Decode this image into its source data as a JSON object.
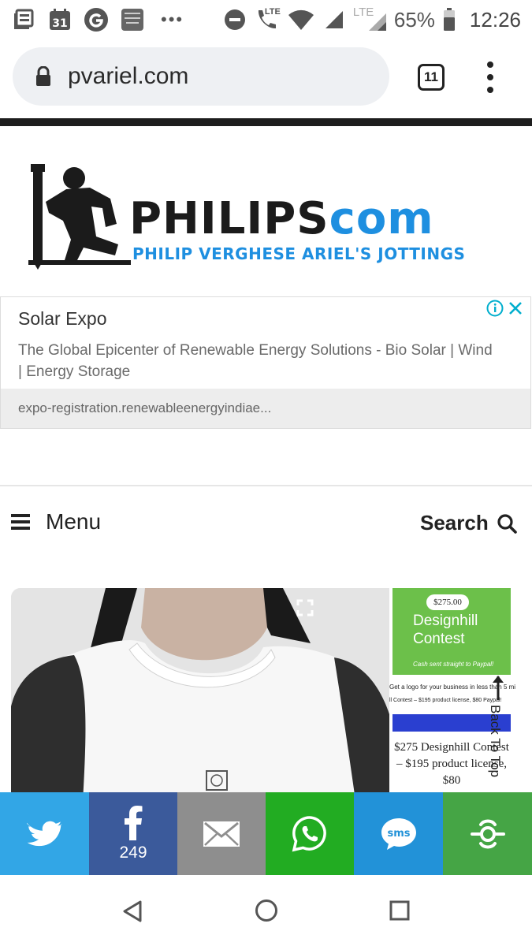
{
  "status_bar": {
    "calendar_day": "31",
    "lte_label_1": "LTE",
    "lte_label_2": "LTE",
    "battery": "65%",
    "time": "12:26",
    "icons": [
      "news-icon",
      "calendar-icon",
      "google-icon",
      "bible-icon",
      "more-dots-icon",
      "do-not-disturb-icon",
      "wifi-call-icon",
      "wifi-icon",
      "signal-icon",
      "signal-icon",
      "battery-icon"
    ]
  },
  "browser": {
    "url": "pvariel.com",
    "tab_count": "11"
  },
  "logo": {
    "word_dark": "PHILIPS",
    "word_blue": "com",
    "tagline": "PHILIP VERGHESE ARIEL'S JOTTINGS",
    "brand_blue": "#1e8fe0"
  },
  "ad": {
    "title": "Solar Expo",
    "description": "The Global Epicenter of Renewable Energy Solutions - Bio Solar | Wind | Energy Storage",
    "url": "expo-registration.renewableenergyindiae..."
  },
  "nav": {
    "menu_label": "Menu",
    "search_label": "Search"
  },
  "side_ad": {
    "price": "$275.00",
    "title": "Designhill Contest",
    "cash_note": "Cash sent straight to Paypal!",
    "line1": "Get a logo for your business in less than 5 mi",
    "line2": "ll Contest – $195 product license, $80 Paypal!",
    "body": "$275 Designhill Contest – $195 product license, $80"
  },
  "back_to_top": {
    "label": "Back To Top"
  },
  "share": {
    "facebook_count": "249",
    "colors": {
      "twitter": "#32a6e6",
      "facebook": "#3b5a9b",
      "email": "#8e8e8e",
      "whatsapp": "#22ac22",
      "sms": "#2292d8",
      "more": "#45a545"
    }
  }
}
